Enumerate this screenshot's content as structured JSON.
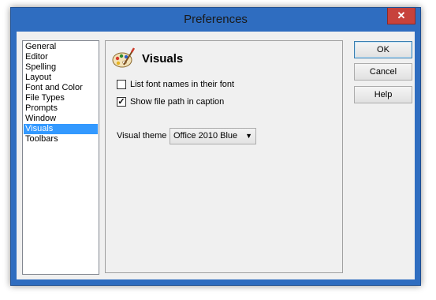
{
  "window": {
    "title": "Preferences"
  },
  "categories": [
    {
      "label": "General",
      "selected": false
    },
    {
      "label": "Editor",
      "selected": false
    },
    {
      "label": "Spelling",
      "selected": false
    },
    {
      "label": "Layout",
      "selected": false
    },
    {
      "label": "Font and Color",
      "selected": false
    },
    {
      "label": "File Types",
      "selected": false
    },
    {
      "label": "Prompts",
      "selected": false
    },
    {
      "label": "Window",
      "selected": false
    },
    {
      "label": "Visuals",
      "selected": true
    },
    {
      "label": "Toolbars",
      "selected": false
    }
  ],
  "panel": {
    "title": "Visuals",
    "icon": "palette-icon",
    "options": [
      {
        "label": "List font names in their font",
        "checked": false
      },
      {
        "label": "Show file path in caption",
        "checked": true
      }
    ],
    "theme_label": "Visual theme",
    "theme_value": "Office 2010 Blue"
  },
  "buttons": {
    "ok": "OK",
    "cancel": "Cancel",
    "help": "Help"
  },
  "colors": {
    "selection": "#3399ff",
    "frame": "#2f6dc0"
  }
}
